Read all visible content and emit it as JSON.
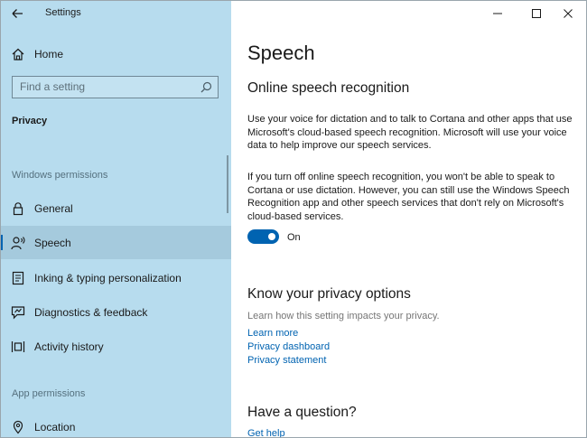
{
  "window": {
    "app_title": "Settings",
    "controls": [
      "minimize-icon",
      "maximize-icon",
      "close-icon"
    ]
  },
  "sidebar": {
    "home_label": "Home",
    "search": {
      "placeholder": "Find a setting",
      "value": ""
    },
    "category": "Privacy",
    "windows_permissions_label": "Windows permissions",
    "items": [
      {
        "label": "General",
        "icon": "lock-icon"
      },
      {
        "label": "Speech",
        "icon": "speech-icon",
        "selected": true
      },
      {
        "label": "Inking & typing personalization",
        "icon": "inking-typing-icon"
      },
      {
        "label": "Diagnostics & feedback",
        "icon": "diagnostics-feedback-icon"
      },
      {
        "label": "Activity history",
        "icon": "activity-history-icon"
      }
    ],
    "app_permissions_label": "App permissions",
    "app_items": [
      {
        "label": "Location",
        "icon": "location-icon"
      }
    ]
  },
  "main": {
    "page_title": "Speech",
    "online": {
      "title": "Online speech recognition",
      "para1": "Use your voice for dictation and to talk to Cortana and other apps that use Microsoft's cloud-based speech recognition. Microsoft will use your voice data to help improve our speech services.",
      "para2": "If you turn off online speech recognition, you won't be able to speak to Cortana or use dictation. However, you can still use the Windows Speech Recognition app and other speech services that don't rely on Microsoft's cloud-based services.",
      "toggle_label": "On",
      "toggle_on": true
    },
    "privacy": {
      "title": "Know your privacy options",
      "description": "Learn how this setting impacts your privacy.",
      "links": [
        "Learn more",
        "Privacy dashboard",
        "Privacy statement"
      ]
    },
    "question": {
      "title": "Have a question?",
      "link": "Get help"
    }
  },
  "colors": {
    "sidebar_bg": "#b7dcee",
    "selected_bg": "#a5cadd",
    "accent": "#0063b1",
    "link": "#0063b1"
  }
}
